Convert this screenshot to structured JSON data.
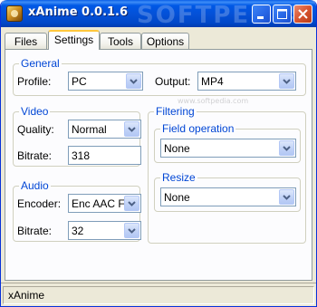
{
  "window": {
    "title": "xAnime 0.0.1.6",
    "watermark": "SOFTPEDIA",
    "watermark_url": "www.softpedia.com"
  },
  "tabs": [
    {
      "label": "Files",
      "active": false
    },
    {
      "label": "Settings",
      "active": true
    },
    {
      "label": "Tools",
      "active": false
    },
    {
      "label": "Options",
      "active": false
    }
  ],
  "general": {
    "legend": "General",
    "profile_label": "Profile:",
    "profile_value": "PC",
    "output_label": "Output:",
    "output_value": "MP4"
  },
  "video": {
    "legend": "Video",
    "quality_label": "Quality:",
    "quality_value": "Normal",
    "bitrate_label": "Bitrate:",
    "bitrate_value": "318"
  },
  "audio": {
    "legend": "Audio",
    "encoder_label": "Encoder:",
    "encoder_value": "Enc AAC F",
    "bitrate_label": "Bitrate:",
    "bitrate_value": "32"
  },
  "filtering": {
    "legend": "Filtering",
    "field_operation": {
      "legend": "Field operation",
      "value": "None"
    },
    "resize": {
      "legend": "Resize",
      "value": "None"
    }
  },
  "status": {
    "text": "xAnime"
  },
  "colors": {
    "titlebar": "#0058E6",
    "legend_text": "#0046D5",
    "active_tab_accent": "#FFC73C",
    "window_bg": "#ECE9D8"
  }
}
